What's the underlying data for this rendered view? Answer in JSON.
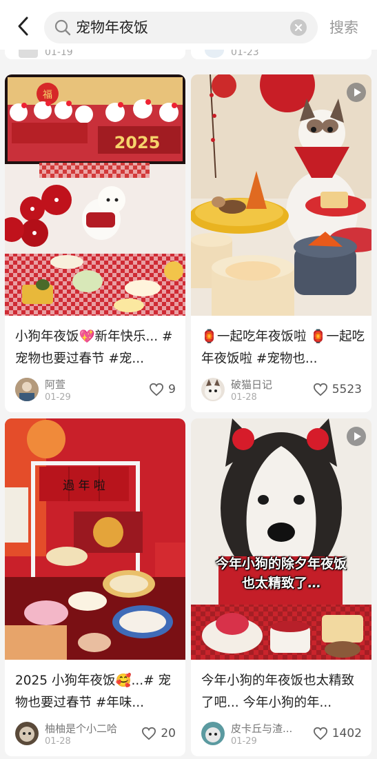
{
  "header": {
    "search_query": "宠物年夜饭",
    "search_button": "搜索"
  },
  "partial_top": [
    {
      "date": "01-19"
    },
    {
      "date": "01-23"
    }
  ],
  "cards": [
    {
      "title": "小狗年夜饭💖新年快乐... #宠物也要过春节 #宠...",
      "author": "阿萱",
      "date": "01-29",
      "likes": "9",
      "image_text": "2025",
      "is_video": false
    },
    {
      "title": "🏮一起吃年夜饭啦 🏮一起吃年夜饭啦 #宠物也...",
      "author": "破猫日记",
      "date": "01-28",
      "likes": "5523",
      "is_video": true
    },
    {
      "title": "2025 小狗年夜饭🥰...# 宠物也要过春节 #年味...",
      "author": "柚柚是个小二哈",
      "date": "01-28",
      "likes": "20",
      "image_text": "過 年 啦",
      "is_video": false
    },
    {
      "title": "今年小狗的年夜饭也太精致了吧... 今年小狗的年...",
      "author": "皮卡丘与渣...",
      "date": "01-29",
      "likes": "1402",
      "image_caption_line1": "今年小狗的除夕年夜饭",
      "image_caption_line2": "也太精致了…",
      "is_video": true
    }
  ],
  "colors": {
    "festive_red": "#c8202a",
    "gold": "#f0c040",
    "text_gray": "#aaa"
  },
  "icons": [
    "back-arrow-icon",
    "search-icon",
    "clear-icon",
    "heart-icon",
    "play-icon"
  ]
}
